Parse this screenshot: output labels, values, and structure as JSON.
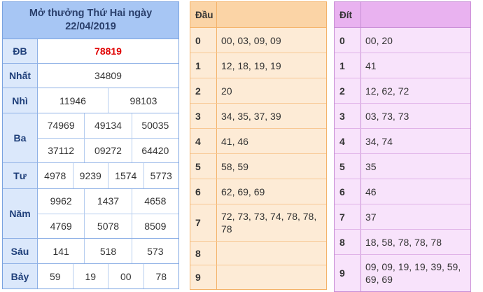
{
  "results": {
    "title_line1": "Mở thưởng Thứ Hai ngày",
    "title_line2": "22/04/2019",
    "rows": [
      {
        "label": "ĐB",
        "lines": [
          [
            "78819"
          ]
        ]
      },
      {
        "label": "Nhất",
        "lines": [
          [
            "34809"
          ]
        ]
      },
      {
        "label": "Nhì",
        "lines": [
          [
            "11946",
            "98103"
          ]
        ]
      },
      {
        "label": "Ba",
        "lines": [
          [
            "74969",
            "49134",
            "50035"
          ],
          [
            "37112",
            "09272",
            "64420"
          ]
        ]
      },
      {
        "label": "Tư",
        "lines": [
          [
            "4978",
            "9239",
            "1574",
            "5773"
          ]
        ]
      },
      {
        "label": "Năm",
        "lines": [
          [
            "9962",
            "1437",
            "4658"
          ],
          [
            "4769",
            "5078",
            "8509"
          ]
        ]
      },
      {
        "label": "Sáu",
        "lines": [
          [
            "141",
            "518",
            "573"
          ]
        ]
      },
      {
        "label": "Bảy",
        "lines": [
          [
            "59",
            "19",
            "00",
            "78"
          ]
        ]
      }
    ]
  },
  "dau": {
    "header": "Đầu",
    "rows": [
      {
        "key": "0",
        "value": "00, 03, 09, 09"
      },
      {
        "key": "1",
        "value": "12, 18, 19, 19"
      },
      {
        "key": "2",
        "value": "20"
      },
      {
        "key": "3",
        "value": "34, 35, 37, 39"
      },
      {
        "key": "4",
        "value": "41, 46"
      },
      {
        "key": "5",
        "value": "58, 59"
      },
      {
        "key": "6",
        "value": "62, 69, 69"
      },
      {
        "key": "7",
        "value": "72, 73, 73, 74, 78, 78, 78"
      },
      {
        "key": "8",
        "value": ""
      },
      {
        "key": "9",
        "value": ""
      }
    ]
  },
  "dit": {
    "header": "Đít",
    "rows": [
      {
        "key": "0",
        "value": "00, 20"
      },
      {
        "key": "1",
        "value": "41"
      },
      {
        "key": "2",
        "value": "12, 62, 72"
      },
      {
        "key": "3",
        "value": "03, 73, 73"
      },
      {
        "key": "4",
        "value": "34, 74"
      },
      {
        "key": "5",
        "value": "35"
      },
      {
        "key": "6",
        "value": "46"
      },
      {
        "key": "7",
        "value": "37"
      },
      {
        "key": "8",
        "value": "18, 58, 78, 78, 78"
      },
      {
        "key": "9",
        "value": "09, 09, 19, 19, 39, 59, 69, 69"
      }
    ]
  },
  "colors": {
    "special_prize": "#e00000",
    "results_header": "#a7c6f4",
    "dau_header": "#fbd4a6",
    "dit_header": "#e9b2f0"
  }
}
